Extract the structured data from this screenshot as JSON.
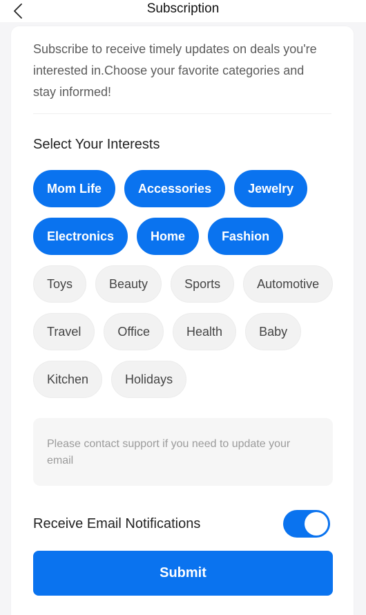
{
  "header": {
    "title": "Subscription",
    "back_icon": "chevron-left-icon"
  },
  "intro": "Subscribe to receive timely updates on deals you're interested in.Choose your favorite categories and stay informed!",
  "interests": {
    "title": "Select Your Interests",
    "chips": [
      {
        "label": "Mom Life",
        "selected": true
      },
      {
        "label": "Accessories",
        "selected": true
      },
      {
        "label": "Jewelry",
        "selected": true
      },
      {
        "label": "Electronics",
        "selected": true
      },
      {
        "label": "Home",
        "selected": true
      },
      {
        "label": "Fashion",
        "selected": true
      },
      {
        "label": "Toys",
        "selected": false
      },
      {
        "label": "Beauty",
        "selected": false
      },
      {
        "label": "Sports",
        "selected": false
      },
      {
        "label": "Automotive",
        "selected": false
      },
      {
        "label": "Travel",
        "selected": false
      },
      {
        "label": "Office",
        "selected": false
      },
      {
        "label": "Health",
        "selected": false
      },
      {
        "label": "Baby",
        "selected": false
      },
      {
        "label": "Kitchen",
        "selected": false
      },
      {
        "label": "Holidays",
        "selected": false
      }
    ]
  },
  "notice": "Please contact support if you need to update your email",
  "email_notifications": {
    "label": "Receive Email Notifications",
    "enabled": true
  },
  "submit_label": "Submit",
  "colors": {
    "accent": "#0a73ef",
    "chip_unselected_bg": "#f2f2f2",
    "notice_bg": "#f6f6f6"
  }
}
